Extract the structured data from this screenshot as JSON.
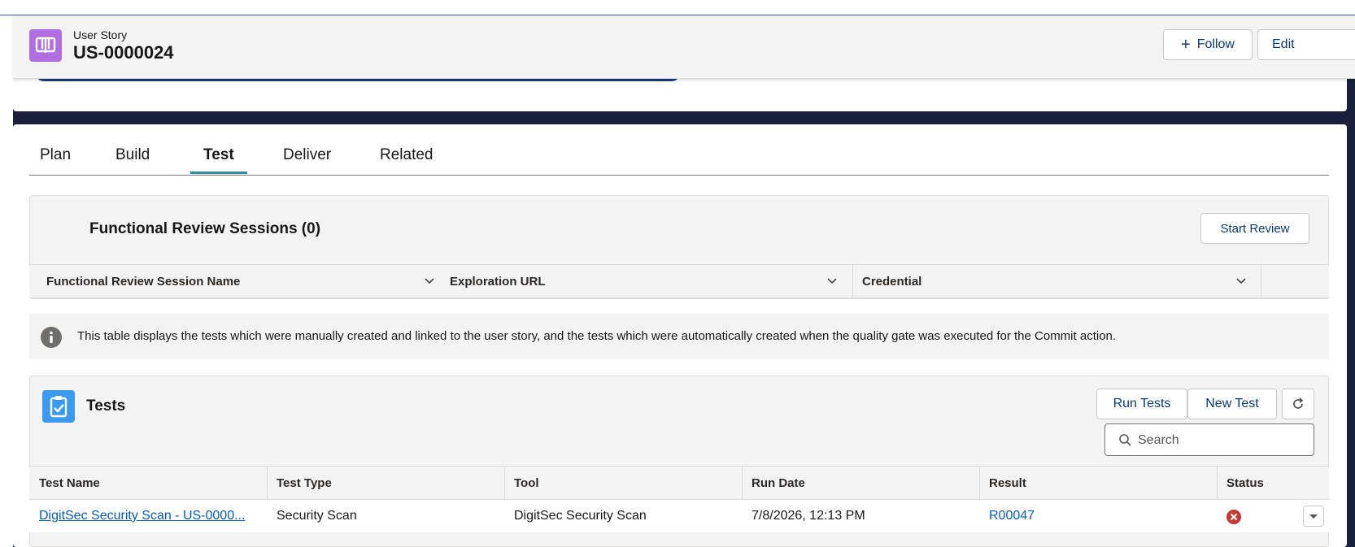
{
  "record": {
    "object_type": "User Story",
    "name": "US-0000024",
    "follow_label": "Follow",
    "edit_label": "Edit",
    "icon": "book-icon"
  },
  "tabs": [
    {
      "label": "Plan",
      "active": false
    },
    {
      "label": "Build",
      "active": false
    },
    {
      "label": "Test",
      "active": true
    },
    {
      "label": "Deliver",
      "active": false
    },
    {
      "label": "Related",
      "active": false
    }
  ],
  "review": {
    "title": "Functional Review Sessions (0)",
    "start_label": "Start Review",
    "columns": [
      "Functional Review Session Name",
      "Exploration URL",
      "Credential"
    ]
  },
  "info": {
    "text": "This table displays the tests which were manually created and linked to the user story, and the tests which were automatically created when the quality gate was executed for the Commit action.",
    "icon": "info-icon"
  },
  "tests": {
    "title": "Tests",
    "icon": "clipboard-check-icon",
    "run_label": "Run Tests",
    "new_label": "New Test",
    "search_placeholder": "Search",
    "columns": [
      "Test Name",
      "Test Type",
      "Tool",
      "Run Date",
      "Result",
      "Status"
    ],
    "rows": [
      {
        "test_name": "DigitSec Security Scan - US-0000...",
        "test_type": "Security Scan",
        "tool": "DigitSec Security Scan",
        "run_date": "7/8/2026, 12:13 PM",
        "result": "R00047",
        "status": "error",
        "status_icon": "error-icon"
      }
    ]
  },
  "colors": {
    "accent": "#0b5cab",
    "tab_active": "#2e8ea0",
    "record_icon": "#b06ee0",
    "tests_icon": "#3b9af0",
    "error": "#c23934",
    "nav_band": "#1a1f3c"
  }
}
